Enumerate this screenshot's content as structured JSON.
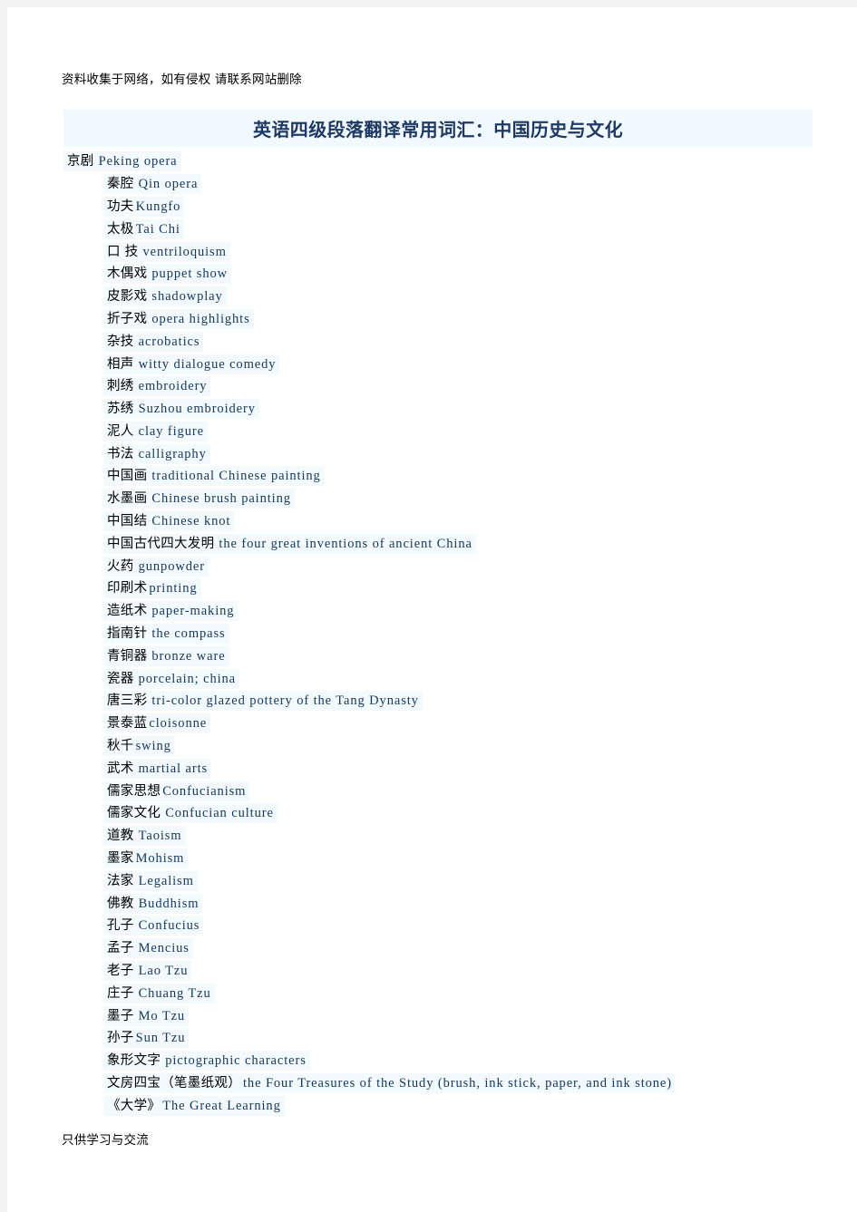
{
  "notice": "资料收集于网络，如有侵权 请联系网站删除",
  "title": "英语四级段落翻译常用词汇：中国历史与文化",
  "footer": "只供学习与交流",
  "colors": {
    "page_background": "#ffffff",
    "canvas_background": "#f4f4f4",
    "title_band": "#f0f9fd",
    "title_text": "#1f3864",
    "row_highlight": "#f2fafd",
    "chinese_text": "#000000",
    "english_text": "#17365d"
  },
  "entries": [
    {
      "cn": "京剧",
      "en": "Peking opera",
      "indent": false
    },
    {
      "cn": "秦腔",
      "en": "Qin opera",
      "indent": true
    },
    {
      "cn": "功夫",
      "en": "Kungfo",
      "indent": true,
      "tight": true
    },
    {
      "cn": "太极",
      "en": "Tai Chi",
      "indent": true,
      "tight": true
    },
    {
      "cn": "口 技",
      "en": "ventriloquism",
      "indent": true
    },
    {
      "cn": "木偶戏",
      "en": "puppet show",
      "indent": true
    },
    {
      "cn": "皮影戏",
      "en": "shadowplay",
      "indent": true
    },
    {
      "cn": "折子戏",
      "en": "opera highlights",
      "indent": true
    },
    {
      "cn": "杂技",
      "en": "acrobatics",
      "indent": true
    },
    {
      "cn": "相声",
      "en": "witty dialogue comedy",
      "indent": true
    },
    {
      "cn": "刺绣",
      "en": "embroidery",
      "indent": true
    },
    {
      "cn": "苏绣",
      "en": "Suzhou embroidery",
      "indent": true
    },
    {
      "cn": "泥人",
      "en": "clay figure",
      "indent": true
    },
    {
      "cn": "书法",
      "en": "calligraphy",
      "indent": true
    },
    {
      "cn": "中国画",
      "en": "traditional Chinese painting",
      "indent": true
    },
    {
      "cn": "水墨画",
      "en": "Chinese brush painting",
      "indent": true
    },
    {
      "cn": "中国结",
      "en": "Chinese knot",
      "indent": true
    },
    {
      "cn": "中国古代四大发明",
      "en": "the four great inventions of ancient China",
      "indent": true
    },
    {
      "cn": "火药",
      "en": "gunpowder",
      "indent": true
    },
    {
      "cn": "印刷术",
      "en": "printing",
      "indent": true,
      "tight": true
    },
    {
      "cn": "造纸术",
      "en": "paper-making",
      "indent": true
    },
    {
      "cn": "指南针",
      "en": "the compass",
      "indent": true
    },
    {
      "cn": "青铜器",
      "en": "bronze ware",
      "indent": true
    },
    {
      "cn": "瓷器",
      "en": "porcelain; china",
      "indent": true
    },
    {
      "cn": "唐三彩",
      "en": "tri-color glazed pottery of the Tang Dynasty",
      "indent": true
    },
    {
      "cn": "景泰蓝",
      "en": "cloisonne",
      "indent": true,
      "tight": true
    },
    {
      "cn": "秋千",
      "en": "swing",
      "indent": true,
      "tight": true
    },
    {
      "cn": "武术",
      "en": "martial arts",
      "indent": true
    },
    {
      "cn": "儒家思想",
      "en": "Confucianism",
      "indent": true,
      "tight": true
    },
    {
      "cn": "儒家文化",
      "en": "Confucian culture",
      "indent": true
    },
    {
      "cn": "道教",
      "en": "Taoism",
      "indent": true
    },
    {
      "cn": "墨家",
      "en": "Mohism",
      "indent": true,
      "tight": true
    },
    {
      "cn": "法家",
      "en": "Legalism",
      "indent": true
    },
    {
      "cn": "佛教",
      "en": "Buddhism",
      "indent": true
    },
    {
      "cn": "孔子",
      "en": "Confucius",
      "indent": true
    },
    {
      "cn": "孟子",
      "en": "Mencius",
      "indent": true
    },
    {
      "cn": "老子",
      "en": "Lao Tzu",
      "indent": true
    },
    {
      "cn": "庄子",
      "en": "Chuang Tzu",
      "indent": true
    },
    {
      "cn": "墨子",
      "en": "Mo Tzu",
      "indent": true
    },
    {
      "cn": "孙子",
      "en": "Sun Tzu",
      "indent": true,
      "tight": true
    },
    {
      "cn": "象形文字",
      "en": "pictographic characters",
      "indent": true
    },
    {
      "cn": "文房四宝（笔墨纸观）",
      "en": "the Four Treasures of the Study (brush, ink stick, paper, and ink stone)",
      "indent": true,
      "tight": true
    },
    {
      "cn": "《大学》",
      "en": "The Great Learning",
      "indent": true,
      "tight": true
    }
  ]
}
